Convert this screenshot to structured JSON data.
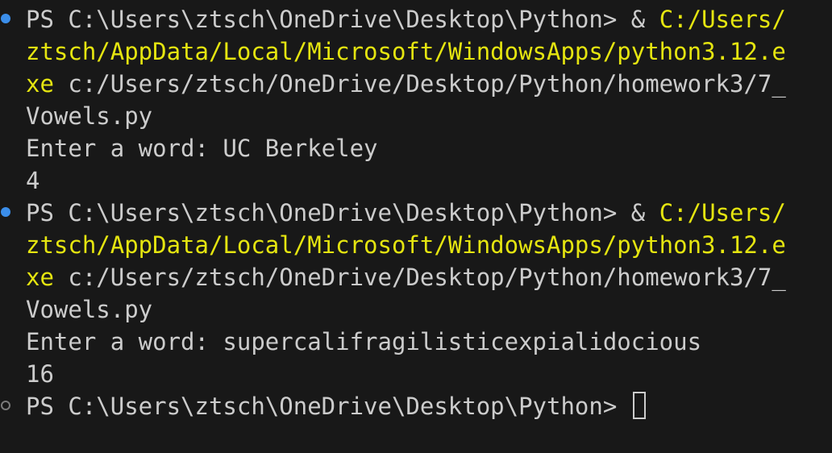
{
  "terminal": {
    "block1": {
      "prompt": "PS C:\\Users\\ztsch\\OneDrive\\Desktop\\Python> & ",
      "path_line1": "C:/Users/",
      "path_line2": "ztsch/AppData/Local/Microsoft/WindowsApps/python3.12.e",
      "path_line3": "xe",
      "arg_line3": " c:/Users/ztsch/OneDrive/Desktop/Python/homework3/7_",
      "arg_line4": "Vowels.py",
      "input_line": "Enter a word: UC Berkeley",
      "output": "4"
    },
    "block2": {
      "prompt": "PS C:\\Users\\ztsch\\OneDrive\\Desktop\\Python> & ",
      "path_line1": "C:/Users/",
      "path_line2": "ztsch/AppData/Local/Microsoft/WindowsApps/python3.12.e",
      "path_line3": "xe",
      "arg_line3": " c:/Users/ztsch/OneDrive/Desktop/Python/homework3/7_",
      "arg_line4": "Vowels.py",
      "input_line": "Enter a word: supercalifragilisticexpialidocious",
      "output": "16"
    },
    "final_prompt": "PS C:\\Users\\ztsch\\OneDrive\\Desktop\\Python> ",
    "colors": {
      "background": "#181818",
      "text": "#cccccc",
      "command_path": "#e5e510",
      "success_marker": "#3b8eea",
      "pending_marker": "#7a7a7a"
    }
  }
}
